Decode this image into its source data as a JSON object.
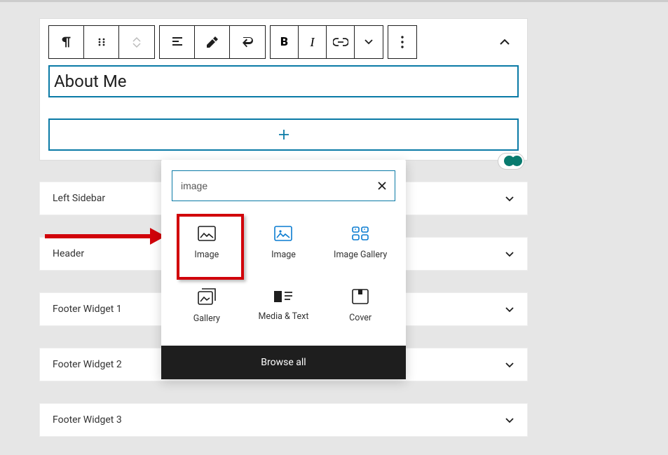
{
  "heading_text": "About Me",
  "toolbar": {
    "items": [
      "paragraph-icon",
      "drag-icon",
      "mover-icon",
      "align-icon",
      "eyedropper-icon",
      "path-icon",
      "bold-icon",
      "italic-icon",
      "link-icon",
      "more-formatting-icon",
      "options-icon"
    ]
  },
  "widgets": [
    {
      "label": "Left Sidebar"
    },
    {
      "label": "Header"
    },
    {
      "label": "Footer Widget 1"
    },
    {
      "label": "Footer Widget 2"
    },
    {
      "label": "Footer Widget 3"
    }
  ],
  "inserter": {
    "search_value": "image",
    "blocks": [
      {
        "name": "Image",
        "icon": "image-outline",
        "color": "#1e1e1e"
      },
      {
        "name": "Image",
        "icon": "image-filled",
        "color": "#0a7cd1"
      },
      {
        "name": "Image Gallery",
        "icon": "grid-4",
        "color": "#0a7cd1"
      },
      {
        "name": "Gallery",
        "icon": "gallery-stack",
        "color": "#1e1e1e"
      },
      {
        "name": "Media & Text",
        "icon": "media-text",
        "color": "#1e1e1e"
      },
      {
        "name": "Cover",
        "icon": "cover",
        "color": "#1e1e1e"
      }
    ],
    "browse_label": "Browse all"
  }
}
